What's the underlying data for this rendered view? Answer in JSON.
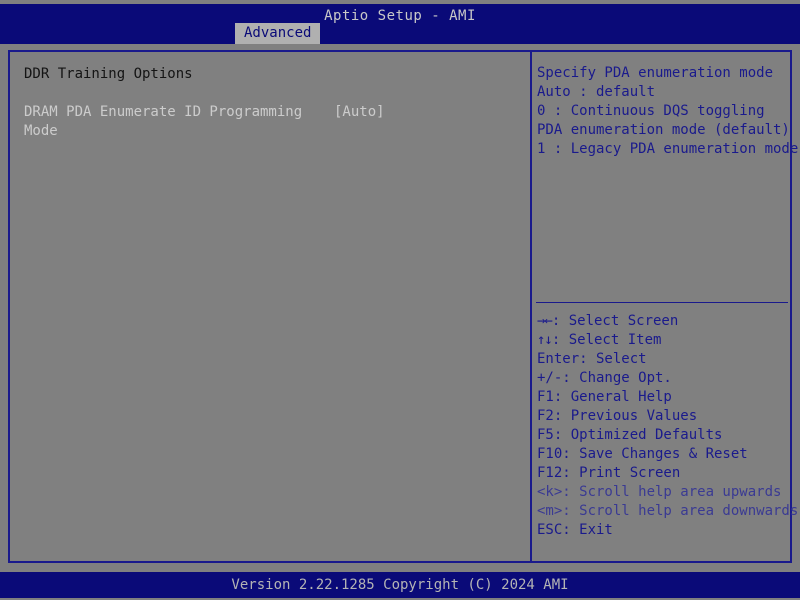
{
  "header": {
    "title": "Aptio Setup - AMI",
    "tabs": [
      {
        "label": "Advanced",
        "active": true
      }
    ]
  },
  "main": {
    "section_title": "DDR Training Options",
    "items": [
      {
        "label_line1": "DRAM PDA Enumerate ID Programming",
        "label_line2": "Mode",
        "value": "[Auto]",
        "enabled": false
      }
    ]
  },
  "help": {
    "lines": [
      "Specify PDA enumeration mode",
      "Auto : default",
      "0 : Continuous DQS toggling",
      "PDA enumeration mode (default)",
      "1 : Legacy PDA enumeration mode"
    ]
  },
  "keys": [
    {
      "glyph": "→←",
      "text": ": Select Screen",
      "dim": false
    },
    {
      "glyph": "↑↓",
      "text": ": Select Item",
      "dim": false
    },
    {
      "glyph": "",
      "text": "Enter: Select",
      "dim": false
    },
    {
      "glyph": "",
      "text": "+/-: Change Opt.",
      "dim": false
    },
    {
      "glyph": "",
      "text": "F1: General Help",
      "dim": false
    },
    {
      "glyph": "",
      "text": "F2: Previous Values",
      "dim": false
    },
    {
      "glyph": "",
      "text": "F5: Optimized Defaults",
      "dim": false
    },
    {
      "glyph": "",
      "text": "F10: Save Changes & Reset",
      "dim": false
    },
    {
      "glyph": "",
      "text": "F12: Print Screen",
      "dim": false
    },
    {
      "glyph": "",
      "text": "<k>: Scroll help area upwards",
      "dim": true
    },
    {
      "glyph": "",
      "text": "<m>: Scroll help area downwards",
      "dim": true
    },
    {
      "glyph": "",
      "text": "ESC: Exit",
      "dim": false
    }
  ],
  "footer": {
    "text": "Version 2.22.1285 Copyright (C) 2024 AMI"
  },
  "colors": {
    "background": "#808080",
    "accent_blue": "#0a0a78",
    "border_blue": "#1a1a8c",
    "tab_active_bg": "#b0b0b0",
    "title_text": "#c8c8c8",
    "menu_text": "#cccccc",
    "section_title_text": "#141414",
    "footer_text": "#b4b4b4"
  }
}
